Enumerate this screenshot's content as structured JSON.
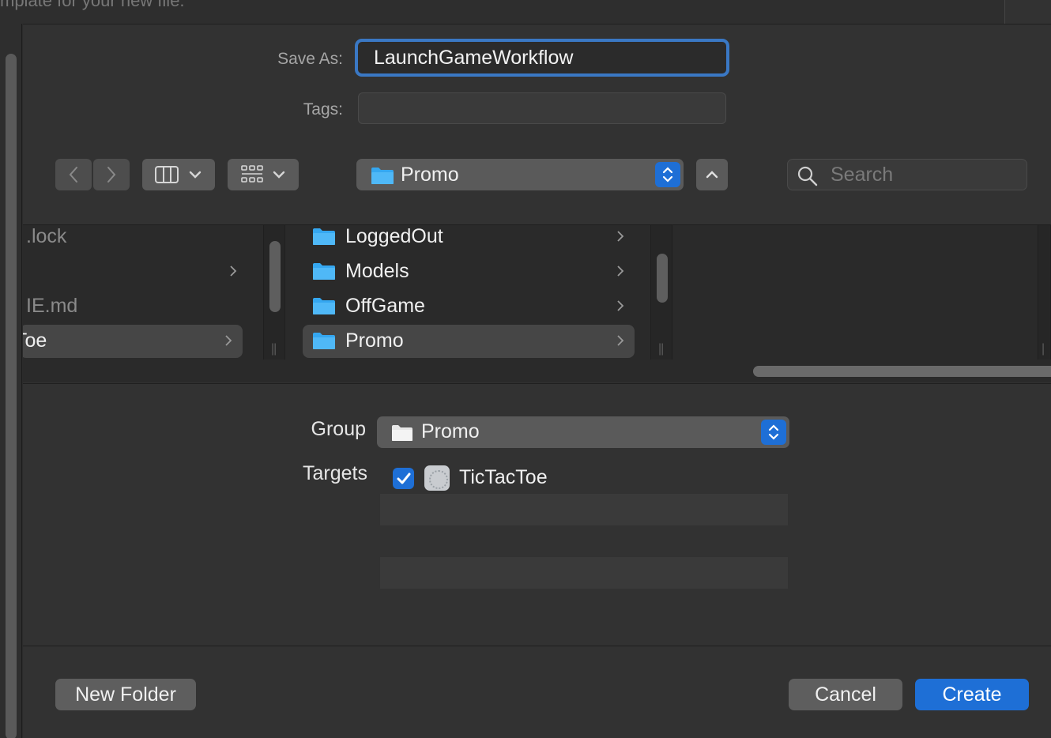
{
  "background_window": {
    "text": "mplate for your new file."
  },
  "save_as": {
    "label": "Save As:",
    "value": "LaunchGameWorkflow"
  },
  "tags": {
    "label": "Tags:",
    "value": ""
  },
  "toolbar": {
    "back_icon": "chevron-left-icon",
    "forward_icon": "chevron-right-icon",
    "view_icon": "column-view-icon",
    "group_icon": "grid-icon",
    "location": "Promo",
    "up_icon": "chevron-up-icon",
    "search_placeholder": "Search"
  },
  "browser": {
    "column1": [
      {
        "label": ".lock",
        "has_children": false,
        "selected": false
      },
      {
        "label": "",
        "has_children": true,
        "selected": false
      },
      {
        "label": "IE.md",
        "has_children": false,
        "selected": false
      },
      {
        "label": "Toe",
        "has_children": true,
        "selected": true
      }
    ],
    "column2": [
      {
        "label": "LoggedOut",
        "has_children": true,
        "selected": false
      },
      {
        "label": "Models",
        "has_children": true,
        "selected": false
      },
      {
        "label": "OffGame",
        "has_children": true,
        "selected": false
      },
      {
        "label": "Promo",
        "has_children": true,
        "selected": true
      }
    ],
    "column3": []
  },
  "group": {
    "label": "Group",
    "value": "Promo"
  },
  "targets": {
    "label": "Targets",
    "items": [
      {
        "name": "TicTacToe",
        "checked": true
      }
    ]
  },
  "buttons": {
    "new_folder": "New Folder",
    "cancel": "Cancel",
    "create": "Create"
  },
  "colors": {
    "accent": "#1e6fd6",
    "focus_ring": "#3a78c4",
    "folder": "#35a7f0"
  }
}
